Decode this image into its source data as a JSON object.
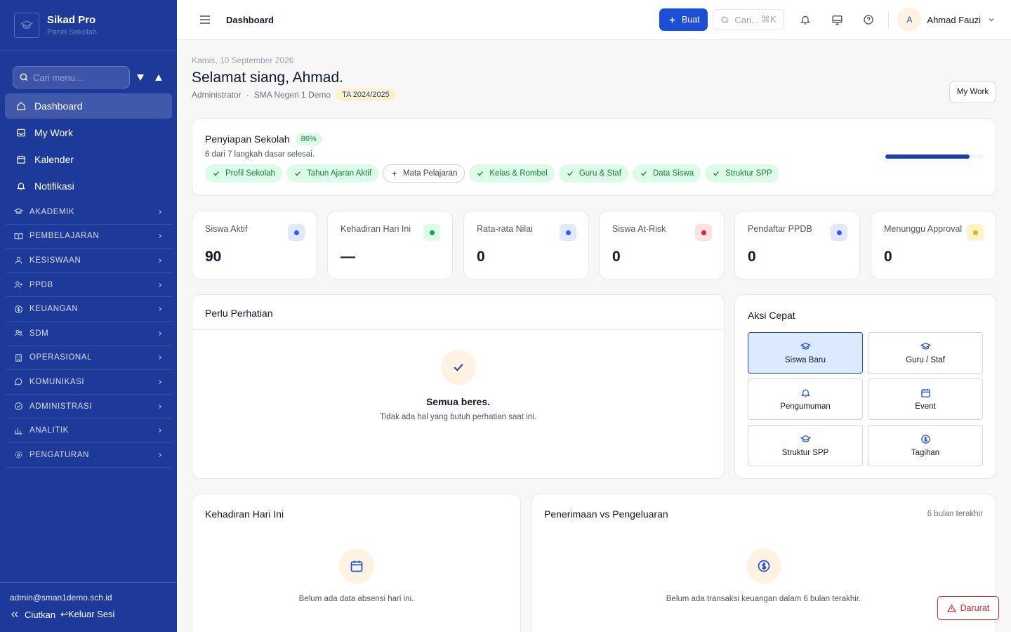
{
  "brand": {
    "name": "Sikad Pro",
    "subtitle": "Panel Sekolah"
  },
  "sidebar": {
    "search_placeholder": "Cari menu...",
    "nav": [
      {
        "label": "Dashboard",
        "icon": "home-icon",
        "active": true
      },
      {
        "label": "My Work",
        "icon": "inbox-icon"
      },
      {
        "label": "Kalender",
        "icon": "calendar-icon"
      },
      {
        "label": "Notifikasi",
        "icon": "bell-icon"
      }
    ],
    "sections": [
      {
        "label": "AKADEMIK",
        "icon": "graduation-cap-icon"
      },
      {
        "label": "PEMBELAJARAN",
        "icon": "book-open-icon"
      },
      {
        "label": "KESISWAAN",
        "icon": "user-icon"
      },
      {
        "label": "PPDB",
        "icon": "user-plus-icon"
      },
      {
        "label": "KEUANGAN",
        "icon": "dollar-circle-icon"
      },
      {
        "label": "SDM",
        "icon": "users-icon"
      },
      {
        "label": "OPERASIONAL",
        "icon": "building-icon"
      },
      {
        "label": "KOMUNIKASI",
        "icon": "message-icon"
      },
      {
        "label": "ADMINISTRASI",
        "icon": "badge-icon"
      },
      {
        "label": "ANALITIK",
        "icon": "bar-chart-icon"
      },
      {
        "label": "PENGATURAN",
        "icon": "gear-icon"
      }
    ],
    "footer": {
      "email": "admin@sman1demo.sch.id",
      "collapse_label": "Ciutkan",
      "logout_label": "↩Keluar Sesi"
    }
  },
  "topbar": {
    "breadcrumb": "Dashboard",
    "create_label": "Buat",
    "search_label": "Cari...",
    "search_shortcut": "⌘K",
    "user": {
      "initial": "A",
      "name": "Ahmad Fauzi"
    }
  },
  "header": {
    "date": "Kamis, 10 September 2026",
    "greeting": "Selamat siang, Ahmad.",
    "role": "Administrator",
    "school": "SMA Negeri 1 Demo",
    "academic_year": "TA 2024/2025",
    "my_work_button": "My Work"
  },
  "setup": {
    "title": "Penyiapan Sekolah",
    "percent_label": "86%",
    "progress": 0.86,
    "subtitle": "6 dari 7 langkah dasar selesai.",
    "steps": [
      {
        "label": "Profil Sekolah",
        "done": true
      },
      {
        "label": "Tahun Ajaran Aktif",
        "done": true
      },
      {
        "label": "Mata Pelajaran",
        "done": false
      },
      {
        "label": "Kelas & Rombel",
        "done": true
      },
      {
        "label": "Guru & Staf",
        "done": true
      },
      {
        "label": "Data Siswa",
        "done": true
      },
      {
        "label": "Struktur SPP",
        "done": true
      }
    ]
  },
  "stats": [
    {
      "label": "Siswa Aktif",
      "value": "90",
      "dot_color": "#2563eb",
      "bg_color": "#e0e7ff"
    },
    {
      "label": "Kehadiran Hari Ini",
      "value": "—",
      "dot_color": "#16a34a",
      "bg_color": "#dcfce7"
    },
    {
      "label": "Rata-rata Nilai",
      "value": "0",
      "dot_color": "#2563eb",
      "bg_color": "#e0e7ff"
    },
    {
      "label": "Siswa At-Risk",
      "value": "0",
      "dot_color": "#dc2626",
      "bg_color": "#fee2e2"
    },
    {
      "label": "Pendaftar PPDB",
      "value": "0",
      "dot_color": "#2563eb",
      "bg_color": "#e0e7ff"
    },
    {
      "label": "Menunggu Approval",
      "value": "0",
      "dot_color": "#eab308",
      "bg_color": "#fef3c7"
    }
  ],
  "attention": {
    "title": "Perlu Perhatian",
    "empty_title": "Semua beres.",
    "empty_sub": "Tidak ada hal yang butuh perhatian saat ini."
  },
  "quick_actions": {
    "title": "Aksi Cepat",
    "items": [
      {
        "label": "Siswa Baru",
        "icon": "graduation-cap-icon",
        "active": true
      },
      {
        "label": "Guru / Staf",
        "icon": "graduation-cap-icon"
      },
      {
        "label": "Pengumuman",
        "icon": "bell-icon"
      },
      {
        "label": "Event",
        "icon": "calendar-icon"
      },
      {
        "label": "Struktur SPP",
        "icon": "graduation-cap-icon"
      },
      {
        "label": "Tagihan",
        "icon": "dollar-circle-icon"
      }
    ]
  },
  "attendance": {
    "title": "Kehadiran Hari Ini",
    "empty": "Belum ada data absensi hari ini."
  },
  "finance": {
    "title": "Penerimaan vs Pengeluaran",
    "period": "6 bulan terakhir",
    "empty": "Belum ada transaksi keuangan dalam 6 bulan terakhir."
  },
  "emergency_label": "Darurat",
  "colors": {
    "sidebar": "#1d3a9a",
    "primary": "#1d4ed8",
    "success": "#15803d",
    "danger": "#dc2626"
  }
}
